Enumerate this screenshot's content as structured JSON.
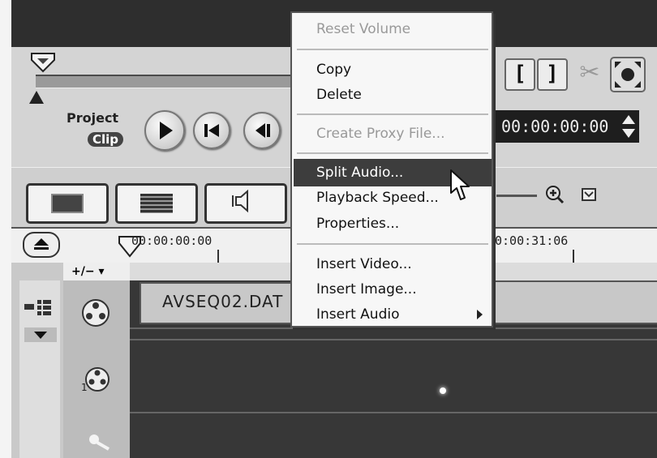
{
  "player": {
    "project_label": "Project",
    "clip_label": "Clip",
    "timecode": "00:00:00:00",
    "mark_in": "[",
    "mark_out": "]"
  },
  "ruler": {
    "start_time": "00:00:00:00",
    "end_time": "0:00:31:06"
  },
  "timeline": {
    "track_control": "+/− ▾",
    "clip_name": "AVSEQ02.DAT"
  },
  "context_menu": {
    "items": [
      {
        "label": "Reset Volume",
        "enabled": false
      },
      {
        "label": "Copy",
        "enabled": true
      },
      {
        "label": "Delete",
        "enabled": true
      },
      {
        "label": "Create Proxy File...",
        "enabled": false
      },
      {
        "label": "Split Audio...",
        "enabled": true,
        "highlighted": true
      },
      {
        "label": "Playback Speed...",
        "enabled": true
      },
      {
        "label": "Properties...",
        "enabled": true
      },
      {
        "label": "Insert Video...",
        "enabled": true
      },
      {
        "label": "Insert Image...",
        "enabled": true
      },
      {
        "label": "Insert Audio",
        "enabled": true,
        "submenu": true
      }
    ]
  },
  "icons": {
    "play": "play-icon",
    "start": "go-to-start-icon",
    "prev_frame": "previous-frame-icon",
    "scissors": "scissors-icon",
    "fullscreen": "fullscreen-icon",
    "eject": "eject-icon",
    "video_track": "film-reel-icon",
    "overlay_track": "overlay-reel-icon",
    "voice_track": "microphone-icon",
    "zoom_in": "zoom-in-icon",
    "fit": "fit-to-window-icon"
  },
  "colors": {
    "menu_highlight": "#3d3d3d",
    "timeline_bg": "#373737",
    "timecode_bg": "#1e1e1e"
  }
}
